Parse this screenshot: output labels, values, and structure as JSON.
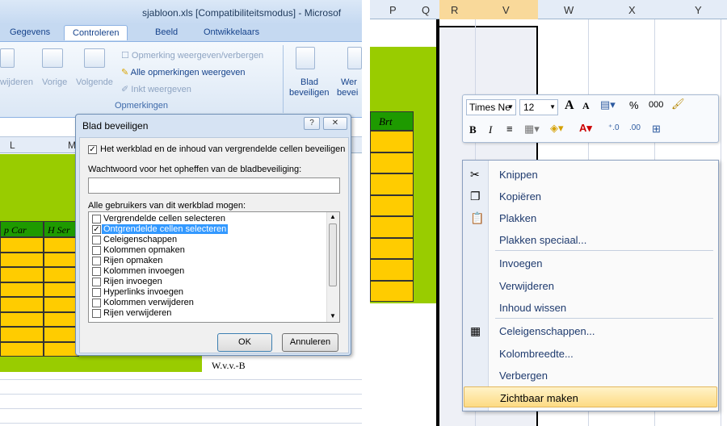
{
  "window_title": "sjabloon.xls  [Compatibiliteitsmodus] - Microsof",
  "ribbon": {
    "tabs": [
      "Gegevens",
      "Controleren",
      "Beeld",
      "Ontwikkelaars"
    ],
    "active_tab": "Controleren",
    "nav_buttons": [
      "wijderen",
      "Vorige",
      "Volgende"
    ],
    "comment_buttons": [
      "Opmerking weergeven/verbergen",
      "Alle opmerkingen weergeven",
      "Inkt weergeven"
    ],
    "group_label": "Opmerkingen",
    "protect_button": [
      "Blad",
      "beveiligen"
    ],
    "protect_button2": [
      "Wer",
      "bevei"
    ]
  },
  "left_sheet": {
    "columns": [
      "L",
      "M"
    ],
    "cell_headers": [
      "p Car",
      "H Ser"
    ],
    "footer_text": "W.v.v.-B"
  },
  "dialog": {
    "title": "Blad beveiligen",
    "help": "?",
    "close": "✕",
    "protect_checkbox": "Het werkblad en de inhoud van vergrendelde cellen beveiligen",
    "protect_checked": true,
    "password_label": "Wachtwoord voor het opheffen van de bladbeveiliging:",
    "password_value": "",
    "allow_label": "Alle gebruikers van dit werkblad mogen:",
    "allow_items": [
      {
        "label": "Vergrendelde cellen selecteren",
        "checked": false
      },
      {
        "label": "Ontgrendelde cellen selecteren",
        "checked": true
      },
      {
        "label": "Celeigenschappen",
        "checked": false
      },
      {
        "label": "Kolommen opmaken",
        "checked": false
      },
      {
        "label": "Rijen opmaken",
        "checked": false
      },
      {
        "label": "Kolommen invoegen",
        "checked": false
      },
      {
        "label": "Rijen invoegen",
        "checked": false
      },
      {
        "label": "Hyperlinks invoegen",
        "checked": false
      },
      {
        "label": "Kolommen verwijderen",
        "checked": false
      },
      {
        "label": "Rijen verwijderen",
        "checked": false
      }
    ],
    "ok": "OK",
    "cancel": "Annuleren"
  },
  "right_sheet": {
    "columns": [
      "P",
      "Q",
      "R",
      "V",
      "W",
      "X",
      "Y"
    ],
    "cell_header": "Brt"
  },
  "mini_toolbar": {
    "font": "Times Ne",
    "size": "12",
    "grow": "A",
    "shrink": "A",
    "percent": "%",
    "thousands": "000",
    "bold": "B",
    "italic": "I"
  },
  "context_menu": {
    "items": [
      {
        "label": "Knippen",
        "icon": "scissors-icon",
        "glyph": "✂"
      },
      {
        "label": "Kopiëren",
        "icon": "copy-icon",
        "glyph": "❐"
      },
      {
        "label": "Plakken",
        "icon": "paste-icon",
        "glyph": "📋"
      },
      {
        "label": "Plakken speciaal...",
        "icon": "",
        "glyph": ""
      },
      {
        "label": "Invoegen",
        "icon": "",
        "glyph": ""
      },
      {
        "label": "Verwijderen",
        "icon": "",
        "glyph": ""
      },
      {
        "label": "Inhoud wissen",
        "icon": "",
        "glyph": ""
      },
      {
        "label": "Celeigenschappen...",
        "icon": "format-cells-icon",
        "glyph": "▦"
      },
      {
        "label": "Kolombreedte...",
        "icon": "",
        "glyph": ""
      },
      {
        "label": "Verbergen",
        "icon": "",
        "glyph": ""
      },
      {
        "label": "Zichtbaar maken",
        "icon": "",
        "glyph": ""
      }
    ],
    "highlighted": "Zichtbaar maken"
  },
  "colors": {
    "green": "#99cc00",
    "yellow": "#ffcc00",
    "selection": "#3399ff"
  }
}
